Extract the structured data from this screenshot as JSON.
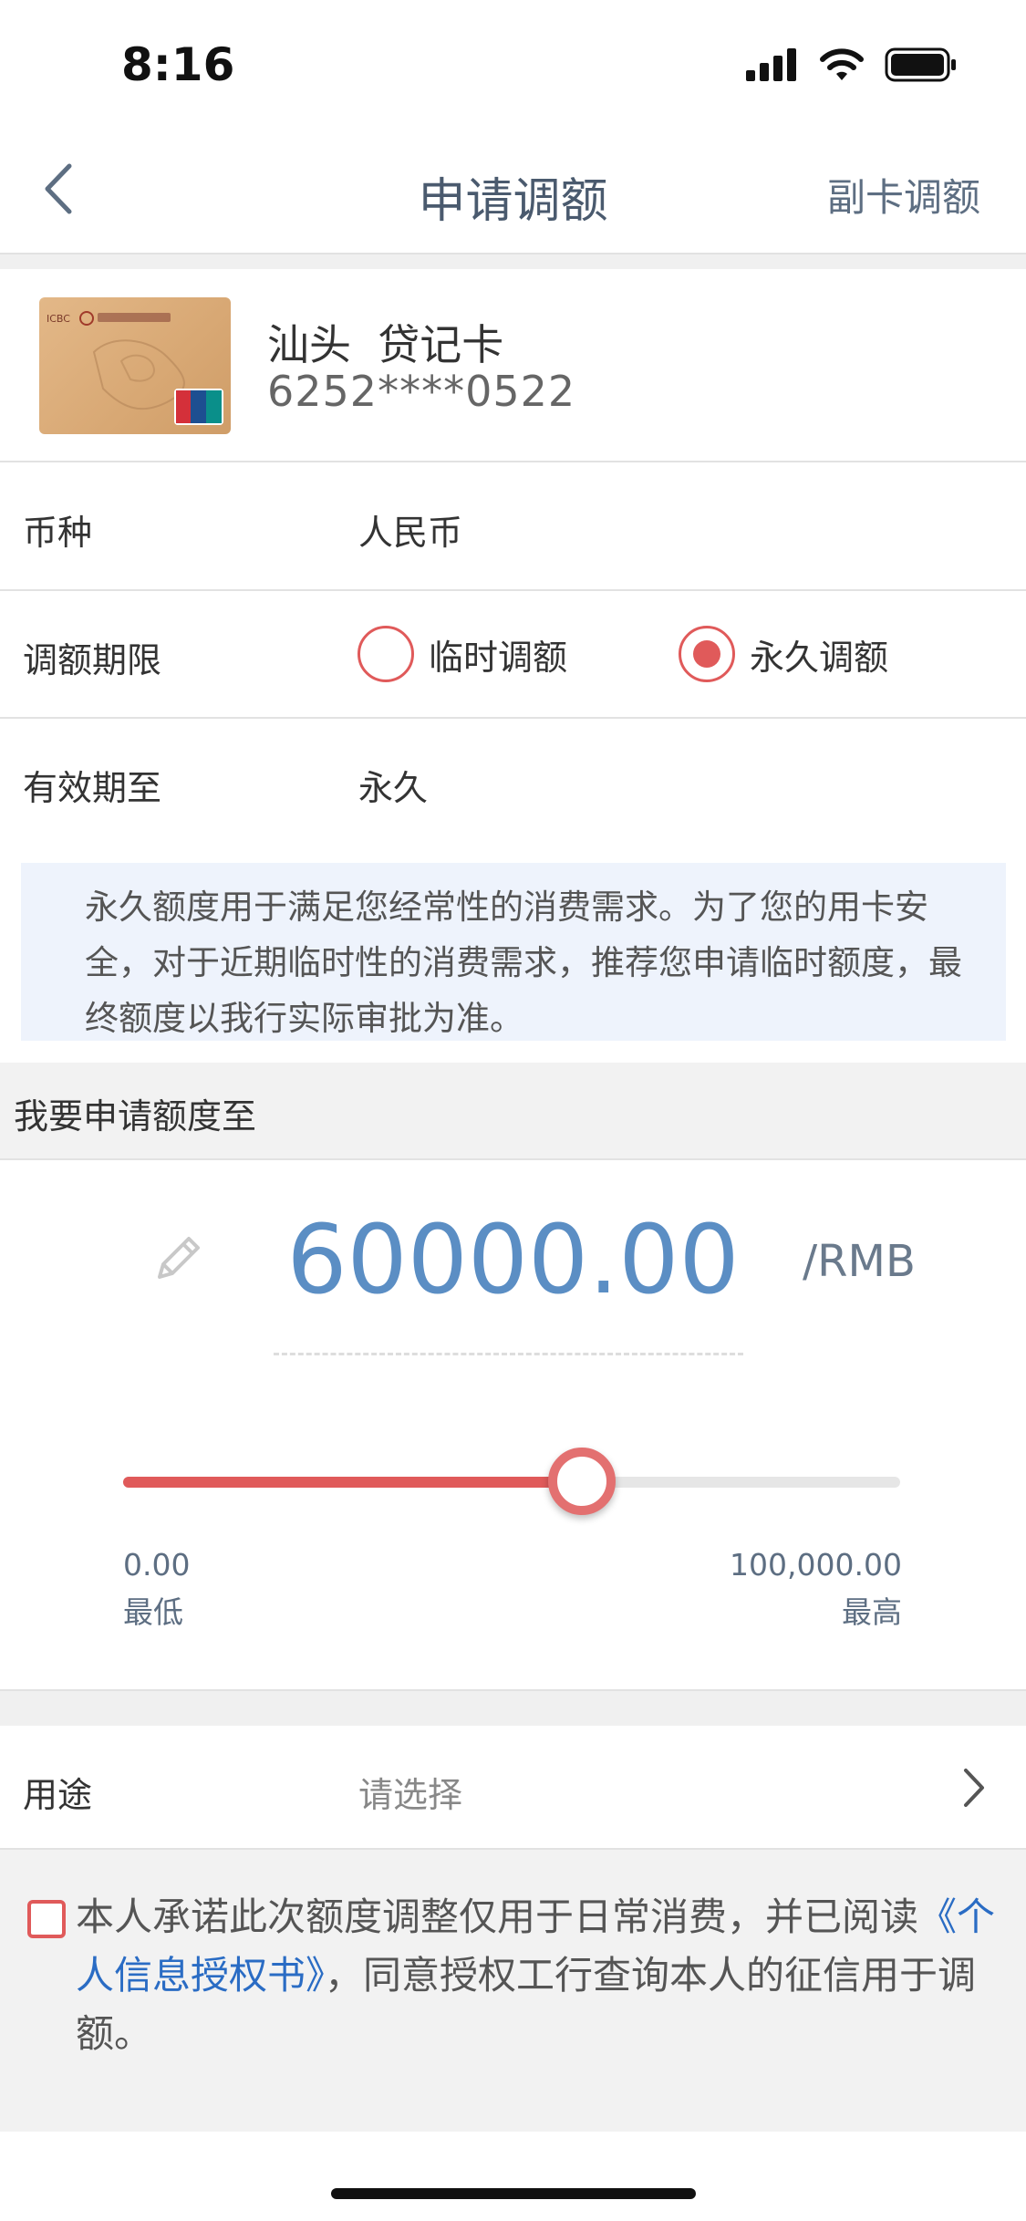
{
  "status_bar": {
    "time": "8:16"
  },
  "nav": {
    "title": "申请调额",
    "right_action": "副卡调额"
  },
  "card": {
    "name": "汕头  贷记卡",
    "number": "6252****0522"
  },
  "currency": {
    "label": "币种",
    "value": "人民币"
  },
  "period": {
    "label": "调额期限",
    "options": [
      {
        "label": "临时调额",
        "selected": false
      },
      {
        "label": "永久调额",
        "selected": true
      }
    ]
  },
  "valid_until": {
    "label": "有效期至",
    "value": "永久"
  },
  "info_text": "永久额度用于满足您经常性的消费需求。为了您的用卡安全，对于近期临时性的消费需求，推荐您申请临时额度，最终额度以我行实际审批为准。",
  "apply": {
    "section_title": "我要申请额度至",
    "amount": "60000.00",
    "unit": "/RMB"
  },
  "slider": {
    "min_value": "0.00",
    "min_label": "最低",
    "max_value": "100,000.00",
    "max_label": "最高",
    "fraction": 0.59
  },
  "purpose": {
    "label": "用途",
    "placeholder": "请选择"
  },
  "agreement": {
    "text_before": "本人承诺此次额度调整仅用于日常消费，并已阅读",
    "link": "《个人信息授权书》",
    "text_after": "，同意授权工行查询本人的征信用于调额。"
  },
  "colors": {
    "accent": "#e05a5a",
    "amount": "#5b8ec4",
    "link": "#2a6cc4",
    "info_bg": "#eef3fc"
  }
}
